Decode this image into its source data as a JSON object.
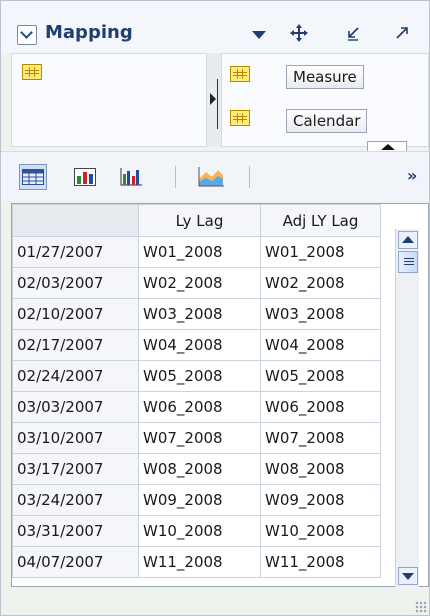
{
  "panel": {
    "title": "Mapping",
    "header_icons": [
      "menu-down-icon",
      "move-icon",
      "minimize-icon",
      "maximize-icon"
    ]
  },
  "dimensions": {
    "left": {
      "icon": "grid-icon"
    },
    "right": [
      {
        "icon": "grid-icon",
        "label": "Measure"
      },
      {
        "icon": "calendar-grid-icon",
        "label": "Calendar"
      }
    ]
  },
  "toolbar": {
    "tools": [
      {
        "icon": "table-view-icon",
        "active": true
      },
      {
        "icon": "table-chart-view-icon",
        "active": false
      },
      {
        "icon": "bar-chart-icon",
        "active": false
      },
      {
        "icon": "area-chart-icon",
        "active": false
      }
    ],
    "overflow": "»"
  },
  "table": {
    "headers": [
      "",
      "Ly Lag",
      "Adj LY Lag"
    ],
    "rows": [
      [
        "01/27/2007",
        "W01_2008",
        "W01_2008"
      ],
      [
        "02/03/2007",
        "W02_2008",
        "W02_2008"
      ],
      [
        "02/10/2007",
        "W03_2008",
        "W03_2008"
      ],
      [
        "02/17/2007",
        "W04_2008",
        "W04_2008"
      ],
      [
        "02/24/2007",
        "W05_2008",
        "W05_2008"
      ],
      [
        "03/03/2007",
        "W06_2008",
        "W06_2008"
      ],
      [
        "03/10/2007",
        "W07_2008",
        "W07_2008"
      ],
      [
        "03/17/2007",
        "W08_2008",
        "W08_2008"
      ],
      [
        "03/24/2007",
        "W09_2008",
        "W09_2008"
      ],
      [
        "03/31/2007",
        "W10_2008",
        "W10_2008"
      ],
      [
        "04/07/2007",
        "W11_2008",
        "W11_2008"
      ]
    ]
  }
}
